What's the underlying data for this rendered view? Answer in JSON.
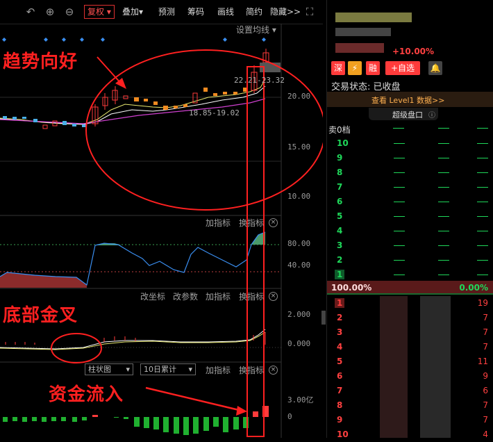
{
  "toolbar": {
    "fuquan": "复权",
    "overlay": "叠加",
    "predict": "预测",
    "chips": "筹码",
    "draw": "画线",
    "simple": "简约",
    "hide": "隐藏>>"
  },
  "main_chart": {
    "set_ma": "设置均线",
    "price_top_label": "22.21-23.32",
    "price_low_label": "18.85-19.02",
    "y_ticks": [
      "20.00",
      "15.00",
      "10.00"
    ]
  },
  "indicator1": {
    "add_indicator": "加指标",
    "change_indicator": "换指标",
    "y_ticks": [
      "80.00",
      "40.00"
    ]
  },
  "indicator2": {
    "change_coord": "改坐标",
    "change_param": "改参数",
    "add_indicator": "加指标",
    "change_indicator": "换指标",
    "y_ticks": [
      "2.000",
      "0.000"
    ]
  },
  "indicator3": {
    "chart_type": "柱状图",
    "accum": "10日累计",
    "add_indicator": "加指标",
    "change_indicator": "换指标",
    "y_ticks": [
      "3.00亿",
      "0"
    ]
  },
  "annotations": {
    "trend": "趋势向好",
    "golden_cross": "底部金叉",
    "inflow": "资金流入"
  },
  "right_panel": {
    "change_pct": "+10.00%",
    "tags": [
      "深",
      "融",
      "+自选"
    ],
    "status_label": "交易状态: 已收盘",
    "level1": "查看 Level1 数据>>",
    "super_panel": "超级盘口",
    "sell_header": "卖0档",
    "sell_levels": [
      "10",
      "9",
      "8",
      "7",
      "6",
      "5",
      "4",
      "3",
      "2",
      "1"
    ],
    "ratio_left": "100.00%",
    "ratio_right": "0.00%",
    "buy_levels": [
      {
        "level": "1",
        "vol": "19"
      },
      {
        "level": "2",
        "vol": "7"
      },
      {
        "level": "3",
        "vol": "7"
      },
      {
        "level": "4",
        "vol": "7"
      },
      {
        "level": "5",
        "vol": "11"
      },
      {
        "level": "6",
        "vol": "9"
      },
      {
        "level": "7",
        "vol": "6"
      },
      {
        "level": "8",
        "vol": "7"
      },
      {
        "level": "9",
        "vol": "7"
      },
      {
        "level": "10",
        "vol": "4"
      }
    ]
  },
  "colors": {
    "up": "#ff3b3b",
    "down": "#1fd85a",
    "accent_red": "#ff2020"
  }
}
